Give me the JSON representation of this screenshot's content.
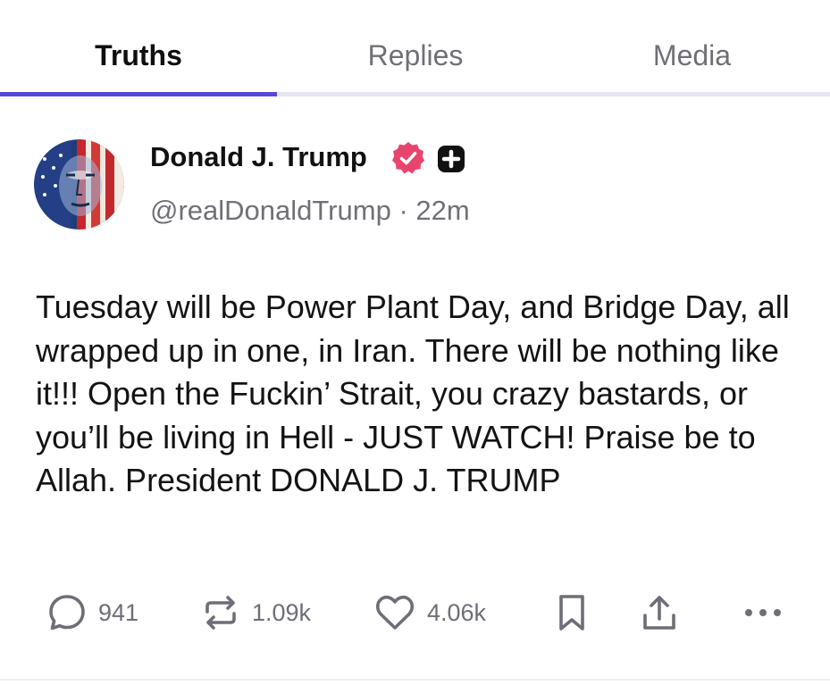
{
  "tabs": [
    {
      "label": "Truths"
    },
    {
      "label": "Replies"
    },
    {
      "label": "Media"
    }
  ],
  "post": {
    "author": {
      "name": "Donald J. Trump",
      "handle": "@realDonaldTrump",
      "separator": "·",
      "time": "22m"
    },
    "text": "Tuesday will be Power Plant Day, and Bridge Day, all wrapped up in one, in Iran. There will be nothing like it!!! Open the Fuckin’ Strait, you crazy bastards, or you’ll be living in Hell - JUST WATCH! Praise be to Allah. President DONALD J. TRUMP",
    "stats": {
      "replies": "941",
      "retruths": "1.09k",
      "likes": "4.06k"
    }
  },
  "colors": {
    "accent": "#5848d6",
    "verified": "#e8456e",
    "muted_text": "#6e6e78"
  },
  "icons": [
    "avatar",
    "verified-badge-icon",
    "plus-badge-icon",
    "reply-icon",
    "retruth-icon",
    "like-icon",
    "bookmark-icon",
    "share-icon",
    "more-icon"
  ]
}
